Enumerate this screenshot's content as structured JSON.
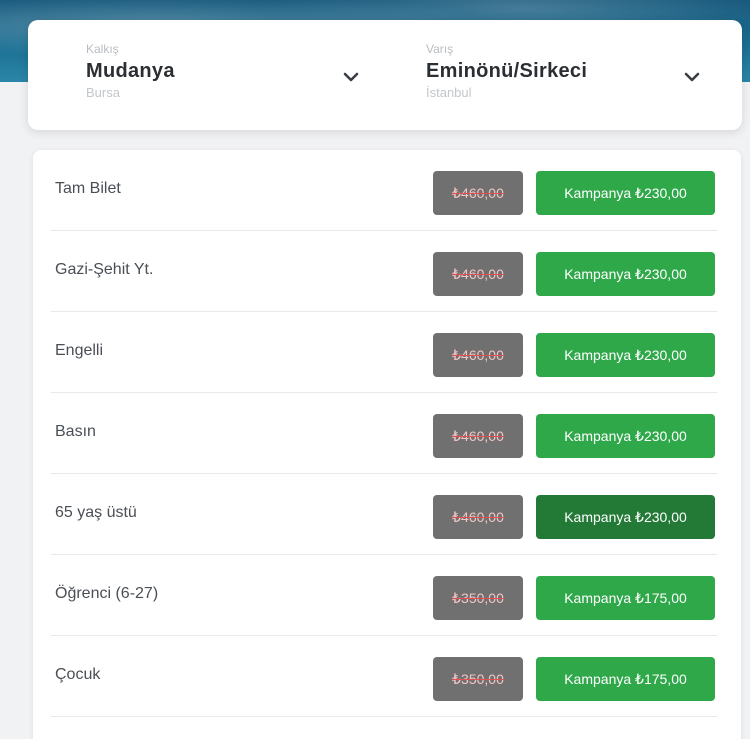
{
  "route": {
    "from": {
      "label": "Kalkış",
      "city": "Mudanya",
      "region": "Bursa"
    },
    "to": {
      "label": "Varış",
      "city": "Eminönü/Sirkeci",
      "region": "İstanbul"
    }
  },
  "fares": [
    {
      "name": "Tam Bilet",
      "old_price": "₺460,00",
      "promo": "Kampanya ₺230,00"
    },
    {
      "name": "Gazi-Şehit Yt.",
      "old_price": "₺460,00",
      "promo": "Kampanya ₺230,00"
    },
    {
      "name": "Engelli",
      "old_price": "₺460,00",
      "promo": "Kampanya ₺230,00"
    },
    {
      "name": "Basın",
      "old_price": "₺460,00",
      "promo": "Kampanya ₺230,00"
    },
    {
      "name": "65 yaş üstü",
      "old_price": "₺460,00",
      "promo": "Kampanya ₺230,00"
    },
    {
      "name": "Öğrenci (6-27)",
      "old_price": "₺350,00",
      "promo": "Kampanya ₺175,00"
    },
    {
      "name": "Çocuk",
      "old_price": "₺350,00",
      "promo": "Kampanya ₺175,00"
    }
  ],
  "colors": {
    "promo_green": "#2fa84a",
    "promo_green_active": "#237a36",
    "old_price_gray": "#707070"
  },
  "icons": {
    "dropdown": "chevron-down-icon"
  }
}
